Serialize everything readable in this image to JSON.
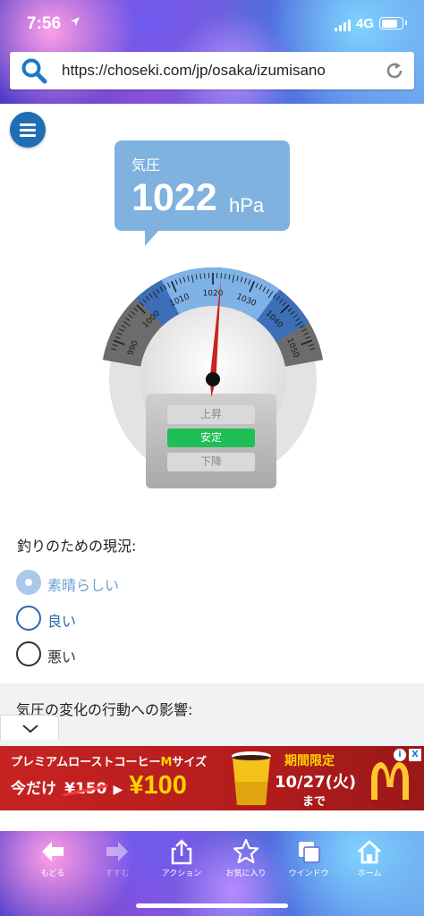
{
  "status_bar": {
    "time": "7:56",
    "location_icon": "location-arrow-icon",
    "network": "4G",
    "battery_level": 0.85
  },
  "browser": {
    "url": "https://choseki.com/jp/osaka/izumisano",
    "search_icon": "search-icon",
    "reload_icon": "reload-icon"
  },
  "pressure": {
    "label": "気圧",
    "value": "1022",
    "unit": "hPa"
  },
  "gauge": {
    "ticks": [
      "990",
      "1000",
      "1010",
      "1020",
      "1030",
      "1040",
      "1050"
    ],
    "needle_value": 1022,
    "range": [
      985,
      1055
    ],
    "colors": {
      "low": "#6c6c6c",
      "mid": "#3d6fb8",
      "high": "#7fb2e6",
      "needle": "#c9231e"
    }
  },
  "trend": {
    "up": "上昇",
    "stable": "安定",
    "down": "下降",
    "active": "stable"
  },
  "fishing": {
    "heading": "釣りのための現況:",
    "options": [
      {
        "label": "素晴らしい",
        "selected": true
      },
      {
        "label": "良い",
        "selected": false
      },
      {
        "label": "悪い",
        "selected": false
      }
    ]
  },
  "influence": {
    "heading": "気圧の変化の行動への影響:"
  },
  "ad": {
    "line1_prefix": "プレミアムローストコーヒー",
    "line1_m": "M",
    "line1_suffix": "サイズ",
    "only": "今だけ",
    "old_price": "¥150",
    "new_price": "¥100",
    "limited": "期間限定",
    "date": "10/27(火)",
    "until": "まで",
    "info": "i",
    "close": "X"
  },
  "toolbar": {
    "back": "もどる",
    "forward": "すすむ",
    "action": "アクション",
    "favorites": "お気に入り",
    "windows": "ウインドウ",
    "home": "ホーム"
  }
}
